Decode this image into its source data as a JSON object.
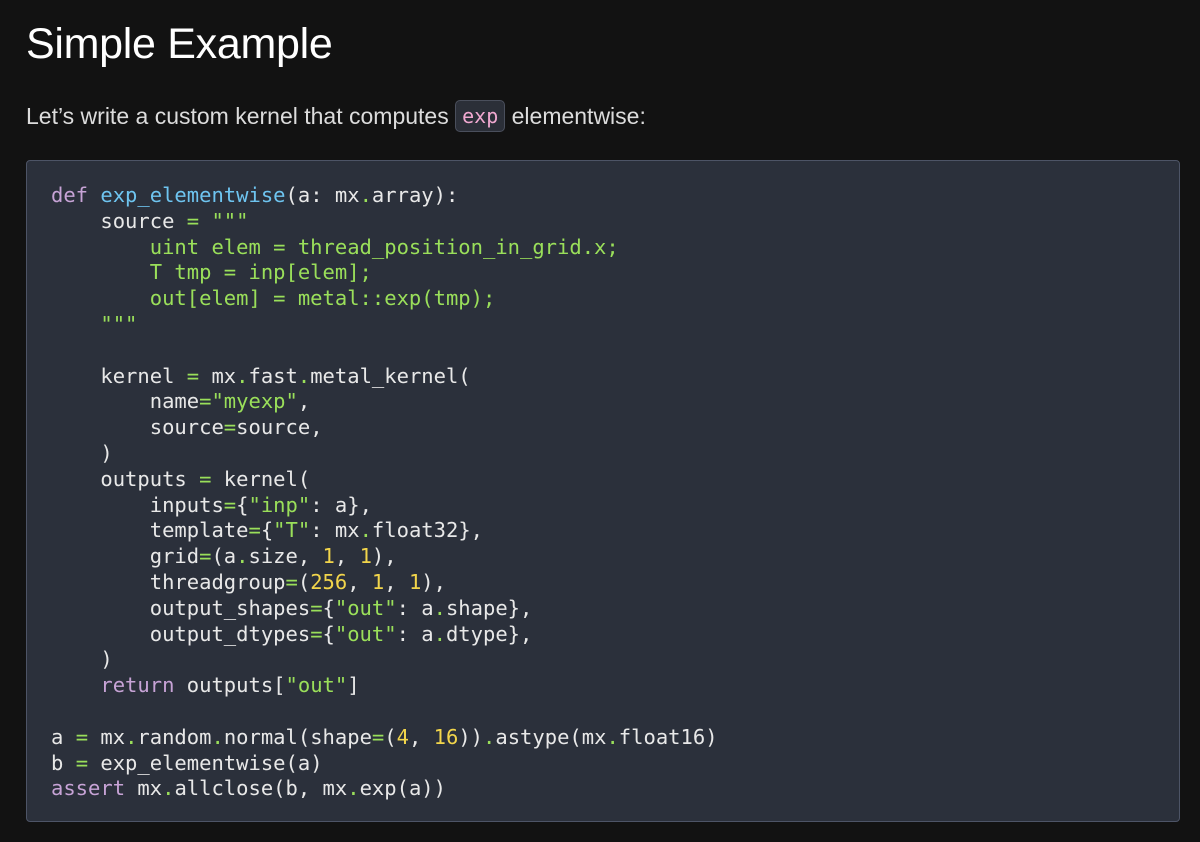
{
  "header": {
    "title": "Simple Example"
  },
  "intro": {
    "before": "Let’s write a custom kernel that computes ",
    "code": "exp",
    "after": " elementwise:"
  },
  "code_block": {
    "lines": [
      [
        [
          "keyword",
          "def"
        ],
        [
          "text",
          " "
        ],
        [
          "function",
          "exp_elementwise"
        ],
        [
          "text",
          "(a: mx"
        ],
        [
          "op",
          "."
        ],
        [
          "text",
          "array):"
        ]
      ],
      [
        [
          "text",
          "    source "
        ],
        [
          "op",
          "="
        ],
        [
          "text",
          " "
        ],
        [
          "string",
          "\"\"\""
        ]
      ],
      [
        [
          "string",
          "        uint elem = thread_position_in_grid.x;"
        ]
      ],
      [
        [
          "string",
          "        T tmp = inp[elem];"
        ]
      ],
      [
        [
          "string",
          "        out[elem] = metal::exp(tmp);"
        ]
      ],
      [
        [
          "string",
          "    \"\"\""
        ]
      ],
      [
        [
          "text",
          ""
        ]
      ],
      [
        [
          "text",
          "    kernel "
        ],
        [
          "op",
          "="
        ],
        [
          "text",
          " mx"
        ],
        [
          "op",
          "."
        ],
        [
          "text",
          "fast"
        ],
        [
          "op",
          "."
        ],
        [
          "text",
          "metal_kernel("
        ]
      ],
      [
        [
          "text",
          "        name"
        ],
        [
          "op",
          "="
        ],
        [
          "string",
          "\"myexp\""
        ],
        [
          "text",
          ","
        ]
      ],
      [
        [
          "text",
          "        source"
        ],
        [
          "op",
          "="
        ],
        [
          "text",
          "source,"
        ]
      ],
      [
        [
          "text",
          "    )"
        ]
      ],
      [
        [
          "text",
          "    outputs "
        ],
        [
          "op",
          "="
        ],
        [
          "text",
          " kernel("
        ]
      ],
      [
        [
          "text",
          "        inputs"
        ],
        [
          "op",
          "="
        ],
        [
          "text",
          "{"
        ],
        [
          "string",
          "\"inp\""
        ],
        [
          "text",
          ": a},"
        ]
      ],
      [
        [
          "text",
          "        template"
        ],
        [
          "op",
          "="
        ],
        [
          "text",
          "{"
        ],
        [
          "string",
          "\"T\""
        ],
        [
          "text",
          ": mx"
        ],
        [
          "op",
          "."
        ],
        [
          "text",
          "float32},"
        ]
      ],
      [
        [
          "text",
          "        grid"
        ],
        [
          "op",
          "="
        ],
        [
          "text",
          "(a"
        ],
        [
          "op",
          "."
        ],
        [
          "text",
          "size, "
        ],
        [
          "number",
          "1"
        ],
        [
          "text",
          ", "
        ],
        [
          "number",
          "1"
        ],
        [
          "text",
          "),"
        ]
      ],
      [
        [
          "text",
          "        threadgroup"
        ],
        [
          "op",
          "="
        ],
        [
          "text",
          "("
        ],
        [
          "number",
          "256"
        ],
        [
          "text",
          ", "
        ],
        [
          "number",
          "1"
        ],
        [
          "text",
          ", "
        ],
        [
          "number",
          "1"
        ],
        [
          "text",
          "),"
        ]
      ],
      [
        [
          "text",
          "        output_shapes"
        ],
        [
          "op",
          "="
        ],
        [
          "text",
          "{"
        ],
        [
          "string",
          "\"out\""
        ],
        [
          "text",
          ": a"
        ],
        [
          "op",
          "."
        ],
        [
          "text",
          "shape},"
        ]
      ],
      [
        [
          "text",
          "        output_dtypes"
        ],
        [
          "op",
          "="
        ],
        [
          "text",
          "{"
        ],
        [
          "string",
          "\"out\""
        ],
        [
          "text",
          ": a"
        ],
        [
          "op",
          "."
        ],
        [
          "text",
          "dtype},"
        ]
      ],
      [
        [
          "text",
          "    )"
        ]
      ],
      [
        [
          "text",
          "    "
        ],
        [
          "keyword",
          "return"
        ],
        [
          "text",
          " outputs["
        ],
        [
          "string",
          "\"out\""
        ],
        [
          "text",
          "]"
        ]
      ],
      [
        [
          "text",
          ""
        ]
      ],
      [
        [
          "text",
          "a "
        ],
        [
          "op",
          "="
        ],
        [
          "text",
          " mx"
        ],
        [
          "op",
          "."
        ],
        [
          "text",
          "random"
        ],
        [
          "op",
          "."
        ],
        [
          "text",
          "normal(shape"
        ],
        [
          "op",
          "="
        ],
        [
          "text",
          "("
        ],
        [
          "number",
          "4"
        ],
        [
          "text",
          ", "
        ],
        [
          "number",
          "16"
        ],
        [
          "text",
          "))"
        ],
        [
          "op",
          "."
        ],
        [
          "text",
          "astype(mx"
        ],
        [
          "op",
          "."
        ],
        [
          "text",
          "float16)"
        ]
      ],
      [
        [
          "text",
          "b "
        ],
        [
          "op",
          "="
        ],
        [
          "text",
          " exp_elementwise(a)"
        ]
      ],
      [
        [
          "keyword",
          "assert"
        ],
        [
          "text",
          " mx"
        ],
        [
          "op",
          "."
        ],
        [
          "text",
          "allclose(b, mx"
        ],
        [
          "op",
          "."
        ],
        [
          "text",
          "exp(a))"
        ]
      ]
    ]
  }
}
